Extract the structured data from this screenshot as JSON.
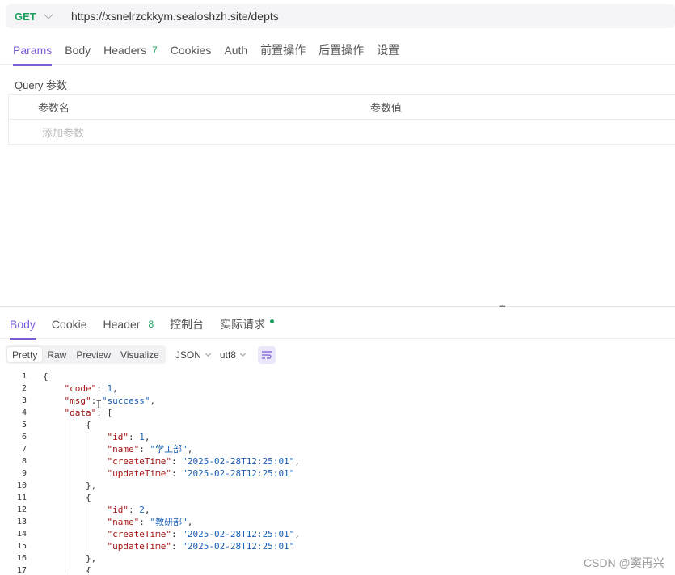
{
  "request": {
    "method": "GET",
    "url": "https://xsnelrzckkym.sealoshzh.site/depts"
  },
  "request_tabs": [
    {
      "label": "Params",
      "active": true
    },
    {
      "label": "Body"
    },
    {
      "label": "Headers",
      "badge": "7"
    },
    {
      "label": "Cookies"
    },
    {
      "label": "Auth"
    },
    {
      "label": "前置操作"
    },
    {
      "label": "后置操作"
    },
    {
      "label": "设置"
    }
  ],
  "params": {
    "title": "Query 参数",
    "col_name": "参数名",
    "col_value": "参数值",
    "add_placeholder": "添加参数"
  },
  "response_tabs": [
    {
      "label": "Body",
      "active": true
    },
    {
      "label": "Cookie"
    },
    {
      "label": "Header",
      "badge": "8"
    },
    {
      "label": "控制台"
    },
    {
      "label": "实际请求"
    }
  ],
  "format": {
    "modes": [
      "Pretty",
      "Raw",
      "Preview",
      "Visualize"
    ],
    "active_mode": "Pretty",
    "language": "JSON",
    "encoding": "utf8"
  },
  "code_lines": [
    {
      "n": "1",
      "t": "{"
    },
    {
      "n": "2",
      "t": "    \"code\": 1,"
    },
    {
      "n": "3",
      "t": "    \"msg\": \"success\","
    },
    {
      "n": "4",
      "t": "    \"data\": ["
    },
    {
      "n": "5",
      "t": "        {"
    },
    {
      "n": "6",
      "t": "            \"id\": 1,"
    },
    {
      "n": "7",
      "t": "            \"name\": \"学工部\","
    },
    {
      "n": "8",
      "t": "            \"createTime\": \"2025-02-28T12:25:01\","
    },
    {
      "n": "9",
      "t": "            \"updateTime\": \"2025-02-28T12:25:01\""
    },
    {
      "n": "10",
      "t": "        },"
    },
    {
      "n": "11",
      "t": "        {"
    },
    {
      "n": "12",
      "t": "            \"id\": 2,"
    },
    {
      "n": "13",
      "t": "            \"name\": \"教研部\","
    },
    {
      "n": "14",
      "t": "            \"createTime\": \"2025-02-28T12:25:01\","
    },
    {
      "n": "15",
      "t": "            \"updateTime\": \"2025-02-28T12:25:01\""
    },
    {
      "n": "16",
      "t": "        },"
    },
    {
      "n": "17",
      "t": "        {"
    }
  ],
  "watermark": "CSDN @窦再兴",
  "colors": {
    "accent": "#7b5cd6",
    "method_green": "#19a05c"
  }
}
